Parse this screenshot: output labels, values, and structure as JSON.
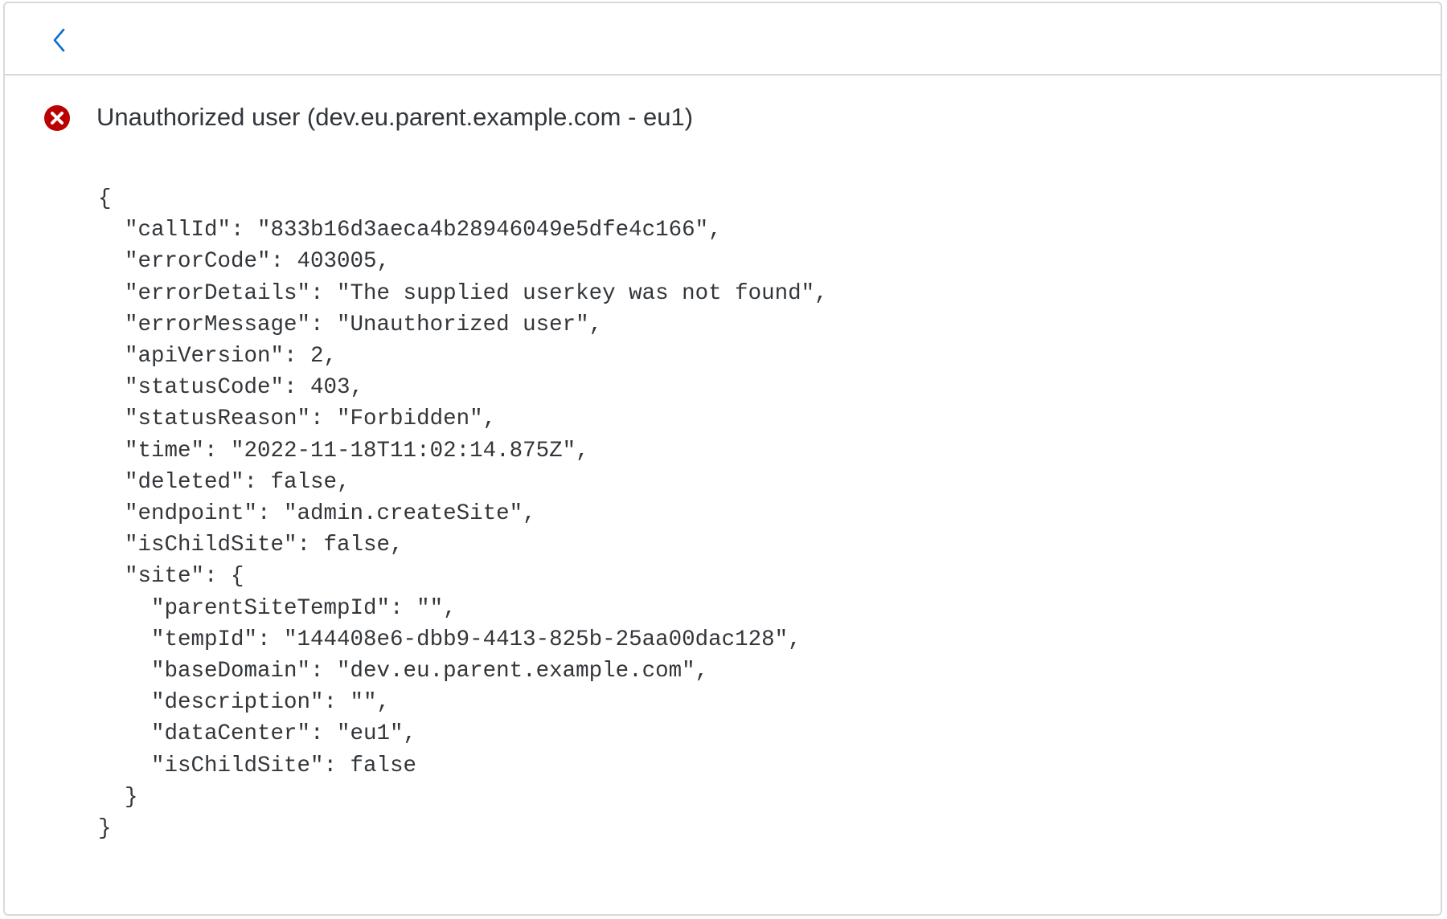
{
  "message": {
    "status": "error",
    "title": "Unauthorized user (dev.eu.parent.example.com - eu1)"
  },
  "details_lines": [
    "{",
    "  \"callId\": \"833b16d3aeca4b28946049e5dfe4c166\",",
    "  \"errorCode\": 403005,",
    "  \"errorDetails\": \"The supplied userkey was not found\",",
    "  \"errorMessage\": \"Unauthorized user\",",
    "  \"apiVersion\": 2,",
    "  \"statusCode\": 403,",
    "  \"statusReason\": \"Forbidden\",",
    "  \"time\": \"2022-11-18T11:02:14.875Z\",",
    "  \"deleted\": false,",
    "  \"endpoint\": \"admin.createSite\",",
    "  \"isChildSite\": false,",
    "  \"site\": {",
    "    \"parentSiteTempId\": \"\",",
    "    \"tempId\": \"144408e6-dbb9-4413-825b-25aa00dac128\",",
    "    \"baseDomain\": \"dev.eu.parent.example.com\",",
    "    \"description\": \"\",",
    "    \"dataCenter\": \"eu1\",",
    "    \"isChildSite\": false",
    "  }",
    "}"
  ],
  "colors": {
    "accent": "#0a6ed1",
    "error": "#bb0000",
    "text": "#32363a",
    "border": "#d9d9d9"
  },
  "icons": {
    "back": "chevron-left-icon",
    "status": "error-circle-icon"
  }
}
